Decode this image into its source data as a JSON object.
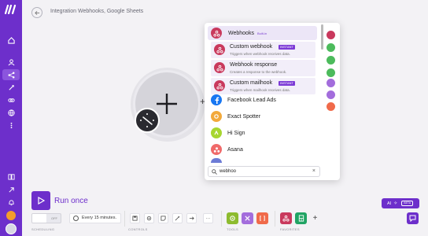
{
  "header": {
    "title": "Integration Webhooks, Google Sheets"
  },
  "module": {
    "add_symbol": "+"
  },
  "dropdown": {
    "header_app": {
      "name": "Webhooks",
      "tag": "Built-in",
      "color": "#c9395d"
    },
    "modules": [
      {
        "name": "Custom webhook",
        "badge": "INSTANT",
        "desc": "Triggers when webhook receives data."
      },
      {
        "name": "Webhook response",
        "badge": "",
        "desc": "Creates a response to the webhook."
      },
      {
        "name": "Custom mailhook",
        "badge": "INSTANT",
        "desc": "Triggers when mailhook receives data."
      }
    ],
    "apps": [
      {
        "name": "Facebook Lead Ads",
        "color": "#1877f2",
        "icon": "facebook-icon"
      },
      {
        "name": "Exact Spotter",
        "color": "#f2a93b",
        "icon": "exact-spotter-icon"
      },
      {
        "name": "Hi Sign",
        "color": "#a7d630",
        "icon": "hi-sign-icon"
      },
      {
        "name": "Asana",
        "color": "#f06a6a",
        "icon": "asana-icon"
      }
    ],
    "search": {
      "value": "webhoo",
      "clear": "×"
    },
    "side_icons": [
      "#c9395d",
      "#4cbb5c",
      "#4cbb5c",
      "#4cbb5c",
      "#a36ddc",
      "#a36ddc",
      "#f06a4a"
    ]
  },
  "bottom": {
    "run_label": "Run once",
    "toggle_off": "OFF",
    "every_label": "Every 15 minutes.",
    "sections": {
      "scheduling": "SCHEDULING",
      "controls": "CONTROLS",
      "tools": "TOOLS",
      "favorites": "FAVORITES"
    },
    "more": "···",
    "add": "+",
    "ai_label": "AI",
    "ai_beta": "BETA"
  },
  "colors": {
    "brand": "#6d2fcb",
    "tools": "#8dbb2f",
    "tools_purple": "#a36ddc",
    "tools_orange": "#f06a4a",
    "sheets": "#21a464"
  }
}
